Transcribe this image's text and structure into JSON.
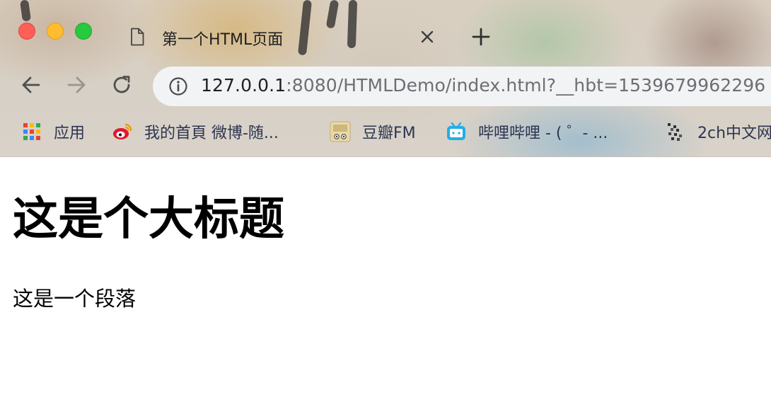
{
  "window": {
    "tab": {
      "title": "第一个HTML页面",
      "icon": "document-icon"
    }
  },
  "toolbar": {
    "url_host": "127.0.0.1",
    "url_rest": ":8080/HTMLDemo/index.html?__hbt=1539679962296"
  },
  "bookmarks": [
    {
      "label": "应用",
      "icon": "apps-grid-icon"
    },
    {
      "label": "我的首頁 微博-随...",
      "icon": "weibo-icon"
    },
    {
      "label": "豆瓣FM",
      "icon": "douban-fm-icon"
    },
    {
      "label": "哔哩哔哩 - ( ゜- ...",
      "icon": "bilibili-icon"
    },
    {
      "label": "2ch中文网",
      "icon": "2ch-icon"
    }
  ],
  "page": {
    "heading": "这是个大标题",
    "paragraph": "这是一个段落"
  }
}
